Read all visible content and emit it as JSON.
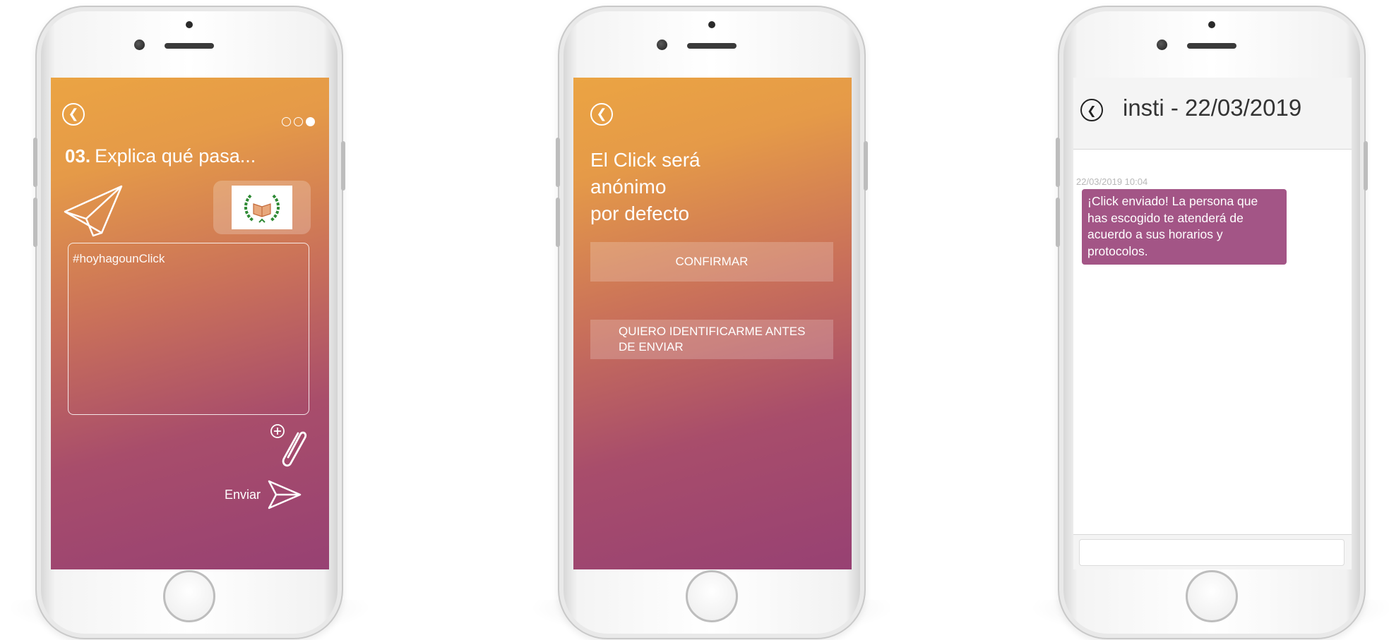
{
  "screen1": {
    "step_number": "03.",
    "step_title": "Explica qué pasa...",
    "message_placeholder": "#hoyhagounClick",
    "send_label": "Enviar",
    "progress": {
      "total_steps": 3,
      "current_step": 3
    }
  },
  "screen2": {
    "anon_line1": "El Click será anónimo",
    "anon_line2": "por defecto",
    "confirm_label": "CONFIRMAR",
    "identify_label_line1": "QUIERO IDENTIFICARME ANTES",
    "identify_label_line2": "DE ENVIAR"
  },
  "screen3": {
    "chat_title": "insti - 22/03/2019",
    "message_time": "22/03/2019 10:04",
    "message_text": "¡Click enviado! La persona que has escogido te atenderá de acuerdo a sus horarios y protocolos."
  },
  "colors": {
    "gradient_top": "#eba443",
    "gradient_bottom": "#974173",
    "bubble": "#a35586",
    "header_bg": "#f4f4f4"
  },
  "icons": [
    "back-arrow-icon",
    "paper-plane-icon",
    "school-logo-icon",
    "attach-plus-icon",
    "send-arrow-icon"
  ]
}
